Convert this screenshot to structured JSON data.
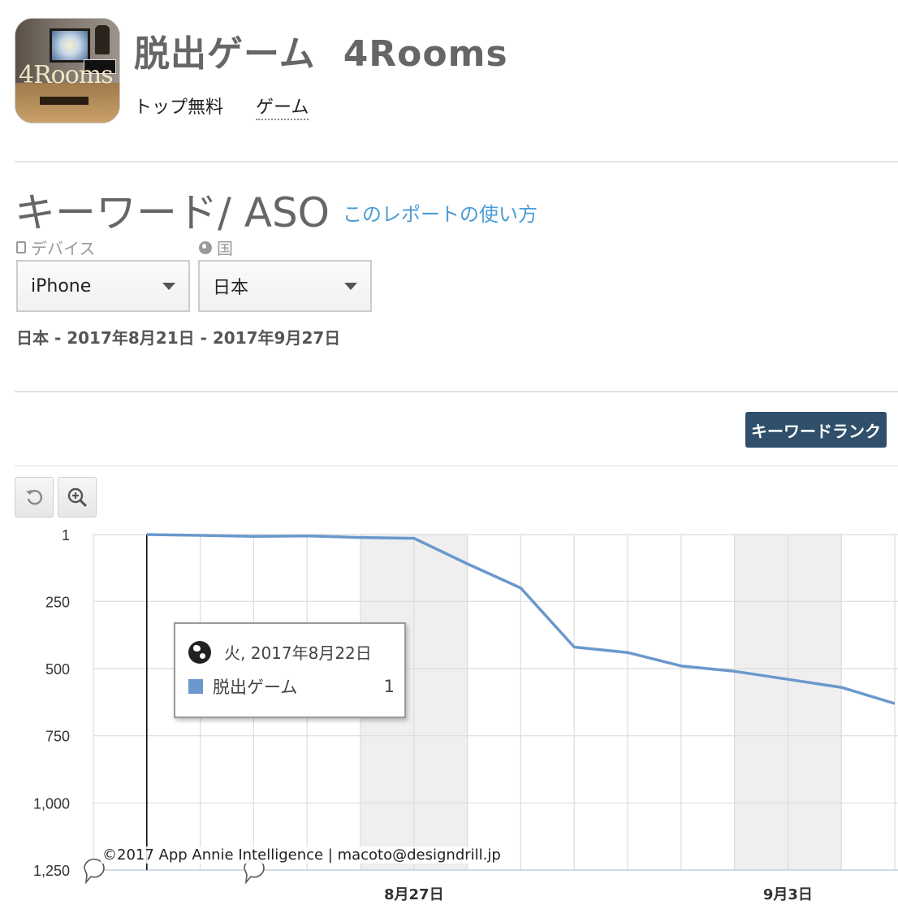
{
  "app": {
    "title": "脱出ゲーム",
    "subtitle": "4Rooms",
    "chart_type": "トップ無料",
    "category": "ゲーム",
    "icon": "app-icon-4rooms"
  },
  "section": {
    "title": "キーワード/ ASO",
    "help_link": "このレポートの使い方"
  },
  "filters": {
    "device_label": "デバイス",
    "device_value": "iPhone",
    "country_label": "国",
    "country_value": "日本"
  },
  "date_range": "日本 - 2017年8月21日 - 2017年9月27日",
  "keyword_rank_button": "キーワードランク",
  "tooltip": {
    "date": "火, 2017年8月22日",
    "series": "脱出ゲーム",
    "value": "1"
  },
  "credit": "©2017 App Annie Intelligence | macoto@designdrill.jp",
  "colors": {
    "series": "#6a98cc",
    "button_bg": "#2f4f6b",
    "link": "#4a9cd6",
    "weekend_band": "#efefef"
  },
  "chart_data": {
    "type": "line",
    "title": "",
    "xlabel": "",
    "ylabel": "",
    "y_inverted": true,
    "ylim": [
      1,
      1250
    ],
    "y_ticks": [
      1,
      250,
      500,
      750,
      1000,
      1250
    ],
    "y_tick_labels": [
      "1",
      "250",
      "500",
      "750",
      "1,000",
      "1,250"
    ],
    "x": [
      "2017-08-21",
      "2017-08-22",
      "2017-08-23",
      "2017-08-24",
      "2017-08-25",
      "2017-08-26",
      "2017-08-27",
      "2017-08-28",
      "2017-08-29",
      "2017-08-30",
      "2017-08-31",
      "2017-09-01",
      "2017-09-02",
      "2017-09-03",
      "2017-09-04",
      "2017-09-05"
    ],
    "x_tick_labels": [
      {
        "x": "2017-08-27",
        "label": "8月27日"
      },
      {
        "x": "2017-09-03",
        "label": "9月3日"
      }
    ],
    "shaded_ranges": [
      [
        "2017-08-26",
        "2017-08-28"
      ],
      [
        "2017-09-02",
        "2017-09-04"
      ]
    ],
    "series": [
      {
        "name": "脱出ゲーム",
        "points": [
          {
            "x": "2017-08-22",
            "y": 1
          },
          {
            "x": "2017-08-23",
            "y": 4
          },
          {
            "x": "2017-08-24",
            "y": 8
          },
          {
            "x": "2017-08-25",
            "y": 6
          },
          {
            "x": "2017-08-26",
            "y": 12
          },
          {
            "x": "2017-08-27",
            "y": 15
          },
          {
            "x": "2017-08-28",
            "y": 110
          },
          {
            "x": "2017-08-29",
            "y": 200
          },
          {
            "x": "2017-08-30",
            "y": 420
          },
          {
            "x": "2017-08-31",
            "y": 440
          },
          {
            "x": "2017-09-01",
            "y": 490
          },
          {
            "x": "2017-09-02",
            "y": 510
          },
          {
            "x": "2017-09-03",
            "y": 540
          },
          {
            "x": "2017-09-04",
            "y": 570
          },
          {
            "x": "2017-09-05",
            "y": 630
          }
        ]
      }
    ],
    "crosshair_x": "2017-08-22",
    "grid": true,
    "legend": "none"
  }
}
